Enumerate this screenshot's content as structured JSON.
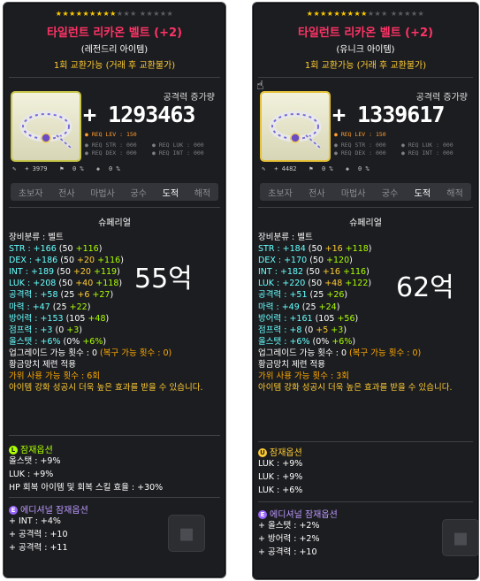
{
  "left": {
    "stars_on": "★★★★★★★",
    "stars_off": "★★★ ★★★★★",
    "stars_on2": "★★",
    "title": "타일런트 리카온 벨트 (+2)",
    "rarity": "(레전드리 아이템)",
    "trade": "1회 교환가능 (거래 후 교환불가)",
    "atk_label": "공격력 증가량",
    "atk_value": "+ 1293463",
    "req_lev": "REQ LEV : 150",
    "req_str": "REQ STR : 000",
    "req_luk": "REQ LUK : 000",
    "req_dex": "REQ DEX : 000",
    "req_int": "REQ INT : 000",
    "misc": [
      "+ 3979",
      "0 %",
      "0 %"
    ],
    "jobs": [
      "초보자",
      "전사",
      "마법사",
      "궁수",
      "도적",
      "해적"
    ],
    "special": "슈페리얼",
    "category": "장비분류 : 벨트",
    "str": "STR : +166 (50 +116)",
    "dex": "DEX : +186 (50 +20 +116)",
    "int": "INT : +189 (50 +20 +119)",
    "luk": "LUK : +208 (50 +40 +118)",
    "att": "공격력 : +58 (25 +6 +27)",
    "matt": "마력 : +47 (25 +22)",
    "def": "방어력 : +153 (105 +48)",
    "jump": "점프력 : +3 (0 +3)",
    "allstat": "올스탯 : +6% (0% +6%)",
    "upgrade": "업그레이드 가능 횟수 : 0",
    "upgrade_recover": "(복구 가능 횟수 : 0)",
    "hammer": "황금망치 제련 적용",
    "scissors": "가위 사용 가능 횟수 : 6회",
    "enhance_note": "아이템 강화 성공시 더욱 높은 효과를 받을 수 있습니다.",
    "price": "55억",
    "potential_head": "잠재옵션",
    "potential_badge": "L",
    "potential": [
      "올스탯 : +9%",
      "LUK : +9%",
      "HP 회복 아이템 및 회복 스킬 효율 : +30%"
    ],
    "additional_head": "에디셔널 잠재옵션",
    "additional_badge": "E",
    "additional": [
      "+ INT : +4%",
      "+ 공격력 : +10",
      "+ 공격력 : +11"
    ]
  },
  "right": {
    "stars_on": "★★★★★★★",
    "stars_on2": "★★",
    "title": "타일런트 리카온 벨트 (+2)",
    "rarity": "(유니크 아이템)",
    "trade": "1회 교환가능 (거래 후 교환불가)",
    "atk_label": "공격력 증가량",
    "atk_value": "+ 1339617",
    "req_lev": "REQ LEV : 150",
    "req_str": "REQ STR : 000",
    "req_luk": "REQ LUK : 000",
    "req_dex": "REQ DEX : 000",
    "req_int": "REQ INT : 000",
    "misc": [
      "+ 4482",
      "0 %",
      "0 %"
    ],
    "jobs": [
      "초보자",
      "전사",
      "마법사",
      "궁수",
      "도적",
      "해적"
    ],
    "special": "슈페리얼",
    "category": "장비분류 : 벨트",
    "str": "STR : +184 (50 +16 +118)",
    "dex": "DEX : +170 (50 +120)",
    "int": "INT : +182 (50 +16 +116)",
    "luk": "LUK : +220 (50 +48 +122)",
    "att": "공격력 : +51 (25 +26)",
    "matt": "마력 : +49 (25 +24)",
    "def": "방어력 : +161 (105 +56)",
    "jump": "점프력 : +8 (0 +5 +3)",
    "allstat": "올스탯 : +6% (0% +6%)",
    "upgrade": "업그레이드 가능 횟수 : 0",
    "upgrade_recover": "(복구 가능 횟수 : 0)",
    "hammer": "황금망치 제련 적용",
    "scissors": "가위 사용 가능 횟수 : 3회",
    "enhance_note": "아이템 강화 성공시 더욱 높은 효과를 받을 수 있습니다.",
    "price": "62억",
    "potential_head": "잠재옵션",
    "potential_badge": "U",
    "potential": [
      "LUK : +9%",
      "LUK : +9%",
      "LUK : +6%"
    ],
    "additional_head": "에디셔널 잠재옵션",
    "additional_badge": "E",
    "additional": [
      "+ 올스탯 : +2%",
      "+ 방어력 : +2%",
      "+ 공격력 : +10"
    ]
  }
}
